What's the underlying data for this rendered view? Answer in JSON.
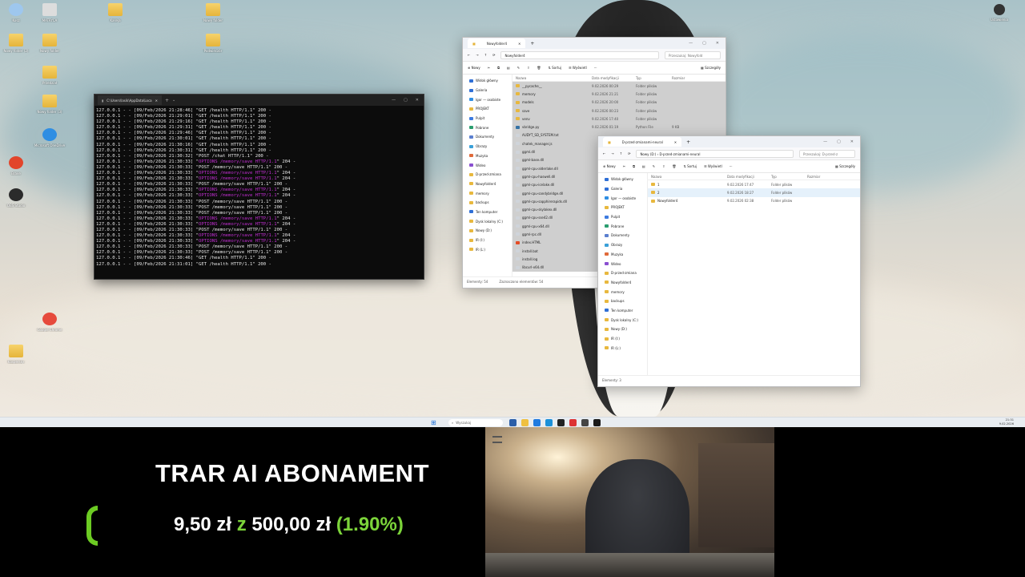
{
  "colors": {
    "accent_green": "#7cd43a",
    "terminal_magenta": "#c02ed0"
  },
  "desktop_icons": [
    {
      "label": "Kosz",
      "icon": "recycle-bin-icon"
    },
    {
      "label": "MATRYCA",
      "icon": "file-icon"
    },
    {
      "label": "Kaseja",
      "icon": "folder-icon"
    },
    {
      "label": "Nowy folder",
      "icon": "folder-icon"
    },
    {
      "label": "Nowy folder (2)",
      "icon": "folder-icon"
    },
    {
      "label": "Nowy folder",
      "icon": "folder-icon"
    },
    {
      "label": "Podwieczór",
      "icon": "folder-icon"
    },
    {
      "label": "Przedział",
      "icon": "folder-icon"
    },
    {
      "label": "Nowy folder (3)",
      "icon": "folder-icon"
    },
    {
      "label": "Microsoft OneDrive",
      "icon": "cloud-icon"
    },
    {
      "label": "Brave",
      "icon": "brave-icon"
    },
    {
      "label": "OBS Studio",
      "icon": "obs-icon"
    },
    {
      "label": "Google Chrome",
      "icon": "chrome-icon"
    },
    {
      "label": "Kaspersky",
      "icon": "folder-icon"
    }
  ],
  "top_right_icon": {
    "label": "Ustawienia",
    "icon": "settings-app-icon"
  },
  "terminal": {
    "title": "C:\\Users\\lasik\\AppData\\Loca",
    "lines": [
      {
        "t": "127.0.0.1 - - [09/Feb/2026 21:28:46] \"GET /health HTTP/1.1\" 200 -",
        "m": false
      },
      {
        "t": "127.0.0.1 - - [09/Feb/2026 21:29:01] \"GET /health HTTP/1.1\" 200 -",
        "m": false
      },
      {
        "t": "127.0.0.1 - - [09/Feb/2026 21:29:16] \"GET /health HTTP/1.1\" 200 -",
        "m": false
      },
      {
        "t": "127.0.0.1 - - [09/Feb/2026 21:29:31] \"GET /health HTTP/1.1\" 200 -",
        "m": false
      },
      {
        "t": "127.0.0.1 - - [09/Feb/2026 21:29:46] \"GET /health HTTP/1.1\" 200 -",
        "m": false
      },
      {
        "t": "127.0.0.1 - - [09/Feb/2026 21:30:01] \"GET /health HTTP/1.1\" 200 -",
        "m": false
      },
      {
        "t": "127.0.0.1 - - [09/Feb/2026 21:30:16] \"GET /health HTTP/1.1\" 200 -",
        "m": false
      },
      {
        "t": "127.0.0.1 - - [09/Feb/2026 21:30:31] \"GET /health HTTP/1.1\" 200 -",
        "m": false
      },
      {
        "t": "127.0.0.1 - - [09/Feb/2026 21:30:32] \"POST /chat HTTP/1.1\" 200 -",
        "m": false
      },
      {
        "t": "127.0.0.1 - - [09/Feb/2026 21:30:33] \"OPTIONS /memory/save HTTP/1.1\" 204 -",
        "m": true
      },
      {
        "t": "127.0.0.1 - - [09/Feb/2026 21:30:33] \"POST /memory/save HTTP/1.1\" 200 -",
        "m": false
      },
      {
        "t": "127.0.0.1 - - [09/Feb/2026 21:30:33] \"OPTIONS /memory/save HTTP/1.1\" 204 -",
        "m": true
      },
      {
        "t": "127.0.0.1 - - [09/Feb/2026 21:30:33] \"OPTIONS /memory/save HTTP/1.1\" 204 -",
        "m": true
      },
      {
        "t": "127.0.0.1 - - [09/Feb/2026 21:30:33] \"POST /memory/save HTTP/1.1\" 200 -",
        "m": false
      },
      {
        "t": "127.0.0.1 - - [09/Feb/2026 21:30:33] \"OPTIONS /memory/save HTTP/1.1\" 204 -",
        "m": true
      },
      {
        "t": "127.0.0.1 - - [09/Feb/2026 21:30:33] \"OPTIONS /memory/save HTTP/1.1\" 204 -",
        "m": true
      },
      {
        "t": "127.0.0.1 - - [09/Feb/2026 21:30:33] \"POST /memory/save HTTP/1.1\" 200 -",
        "m": false
      },
      {
        "t": "127.0.0.1 - - [09/Feb/2026 21:30:33] \"POST /memory/save HTTP/1.1\" 200 -",
        "m": false
      },
      {
        "t": "127.0.0.1 - - [09/Feb/2026 21:30:33] \"POST /memory/save HTTP/1.1\" 200 -",
        "m": false
      },
      {
        "t": "127.0.0.1 - - [09/Feb/2026 21:30:33] \"OPTIONS /memory/save HTTP/1.1\" 204 -",
        "m": true
      },
      {
        "t": "127.0.0.1 - - [09/Feb/2026 21:30:33] \"OPTIONS /memory/save HTTP/1.1\" 204 -",
        "m": true
      },
      {
        "t": "127.0.0.1 - - [09/Feb/2026 21:30:33] \"POST /memory/save HTTP/1.1\" 200 -",
        "m": false
      },
      {
        "t": "127.0.0.1 - - [09/Feb/2026 21:30:33] \"OPTIONS /memory/save HTTP/1.1\" 204 -",
        "m": true
      },
      {
        "t": "127.0.0.1 - - [09/Feb/2026 21:30:33] \"OPTIONS /memory/save HTTP/1.1\" 204 -",
        "m": true
      },
      {
        "t": "127.0.0.1 - - [09/Feb/2026 21:30:33] \"POST /memory/save HTTP/1.1\" 200 -",
        "m": false
      },
      {
        "t": "127.0.0.1 - - [09/Feb/2026 21:30:33] \"POST /memory/save HTTP/1.1\" 200 -",
        "m": false
      },
      {
        "t": "127.0.0.1 - - [09/Feb/2026 21:30:46] \"GET /health HTTP/1.1\" 200 -",
        "m": false
      },
      {
        "t": "127.0.0.1 - - [09/Feb/2026 21:31:01] \"GET /health HTTP/1.1\" 200 -",
        "m": false
      }
    ]
  },
  "explorer1": {
    "tab": "Nowyfolder4",
    "path": "Nowyfolder4",
    "search": "Przeszukaj: Nowyfold",
    "cmd": {
      "new": "Nowy",
      "sort": "Sortuj",
      "view": "Wyświetl",
      "details": "Szczegóły"
    },
    "columns": [
      "Nazwa",
      "Data modyfikacji",
      "Typ",
      "Rozmiar"
    ],
    "nav": [
      "Widok główny",
      "Galeria",
      "Igor — osobiste",
      "PROJEKT",
      "Pulpit",
      "Pobrane",
      "Dokumenty",
      "Obrazy",
      "Muzyka",
      "Wideo",
      "D-przed-zmiana",
      "Nowyfolder4",
      "memory",
      "backups",
      "Ten komputer",
      "Dysk lokalny (C:)",
      "Nowy (D:)",
      "IR (I:)",
      "IR (L:)"
    ],
    "files": [
      {
        "name": "__pycache__",
        "date": "9.02.2026 00:29",
        "type": "Folder plików",
        "size": "",
        "kind": "folder"
      },
      {
        "name": "memory",
        "date": "9.02.2026 21:21",
        "type": "Folder plików",
        "size": "",
        "kind": "folder"
      },
      {
        "name": "models",
        "date": "9.02.2026 20:00",
        "type": "Folder plików",
        "size": "",
        "kind": "folder"
      },
      {
        "name": "save",
        "date": "9.02.2026 00:23",
        "type": "Folder plików",
        "size": "",
        "kind": "folder"
      },
      {
        "name": "venv",
        "date": "9.02.2026 17:40",
        "type": "Folder plików",
        "size": "",
        "kind": "folder"
      },
      {
        "name": "vbridge.py",
        "date": "9.02.2026 01:19",
        "type": "Python File",
        "size": "9 KB",
        "kind": "py"
      },
      {
        "name": "AUDYT_SD_SYSTEM.txt",
        "date": "",
        "type": "",
        "size": "",
        "kind": "file"
      },
      {
        "name": "chatek_manager.js",
        "date": "",
        "type": "",
        "size": "",
        "kind": "file"
      },
      {
        "name": "ggml.dll",
        "date": "",
        "type": "",
        "size": "",
        "kind": "file"
      },
      {
        "name": "ggml-base.dll",
        "date": "",
        "type": "",
        "size": "",
        "kind": "file"
      },
      {
        "name": "ggml-cpu-alderlake.dll",
        "date": "",
        "type": "",
        "size": "",
        "kind": "file"
      },
      {
        "name": "ggml-cpu-haswell.dll",
        "date": "",
        "type": "",
        "size": "",
        "kind": "file"
      },
      {
        "name": "ggml-cpu-icelake.dll",
        "date": "",
        "type": "",
        "size": "",
        "kind": "file"
      },
      {
        "name": "ggml-cpu-sandybridge.dll",
        "date": "",
        "type": "",
        "size": "",
        "kind": "file"
      },
      {
        "name": "ggml-cpu-sapphirerapids.dll",
        "date": "",
        "type": "",
        "size": "",
        "kind": "file"
      },
      {
        "name": "ggml-cpu-skylakex.dll",
        "date": "",
        "type": "",
        "size": "",
        "kind": "file"
      },
      {
        "name": "ggml-cpu-sse42.dll",
        "date": "",
        "type": "",
        "size": "",
        "kind": "file"
      },
      {
        "name": "ggml-cpu-x64.dll",
        "date": "",
        "type": "",
        "size": "",
        "kind": "file"
      },
      {
        "name": "ggml-rpc.dll",
        "date": "",
        "type": "",
        "size": "",
        "kind": "file"
      },
      {
        "name": "index.HTML",
        "date": "",
        "type": "",
        "size": "",
        "kind": "html"
      },
      {
        "name": "install.bat",
        "date": "",
        "type": "",
        "size": "",
        "kind": "file"
      },
      {
        "name": "install.log",
        "date": "",
        "type": "",
        "size": "",
        "kind": "file"
      },
      {
        "name": "libcurl-x64.dll",
        "date": "",
        "type": "",
        "size": "",
        "kind": "file"
      }
    ],
    "status": "Elementy: 54",
    "status2": "Zaznaczono elementów: 54"
  },
  "explorer2": {
    "tab": "D-przed-zmianami-neural",
    "path_root": "Nowy (D:)",
    "path": "D-przed-zmianami-neural",
    "search": "Przeszukaj: D-przed-z",
    "cmd": {
      "new": "Nowy",
      "sort": "Sortuj",
      "view": "Wyświetl",
      "details": "Szczegóły"
    },
    "columns": [
      "Nazwa",
      "Data modyfikacji",
      "Typ",
      "Rozmiar"
    ],
    "nav": [
      "Widok główny",
      "Galeria",
      "Igor — osobiste",
      "PROJEKT",
      "Pulpit",
      "Pobrane",
      "Dokumenty",
      "Obrazy",
      "Muzyka",
      "Wideo",
      "D-przed-zmiana",
      "Nowyfolder4",
      "memory",
      "backups",
      "Ten komputer",
      "Dysk lokalny (C:)",
      "Nowy (D:)",
      "IR (I:)",
      "IR (L:)"
    ],
    "files": [
      {
        "name": "1",
        "date": "9.02.2026 17:47",
        "type": "Folder plików",
        "size": "",
        "kind": "folder"
      },
      {
        "name": "2",
        "date": "9.02.2026 18:27",
        "type": "Folder plików",
        "size": "",
        "kind": "folder"
      },
      {
        "name": "Nowyfolder4",
        "date": "9.02.2026 02:38",
        "type": "Folder plików",
        "size": "",
        "kind": "folder"
      }
    ],
    "status": "Elementy: 3"
  },
  "taskbar": {
    "search": "Wyszukaj",
    "time": "21:31",
    "date": "9.02.2026"
  },
  "overlay": {
    "title": "TRAR AI ABONAMENT",
    "amount_current": "9,50 zł",
    "amount_sep": "z",
    "amount_goal": "500,00 zł",
    "percent": "(1.90%)",
    "progress_fraction": 0.019
  }
}
